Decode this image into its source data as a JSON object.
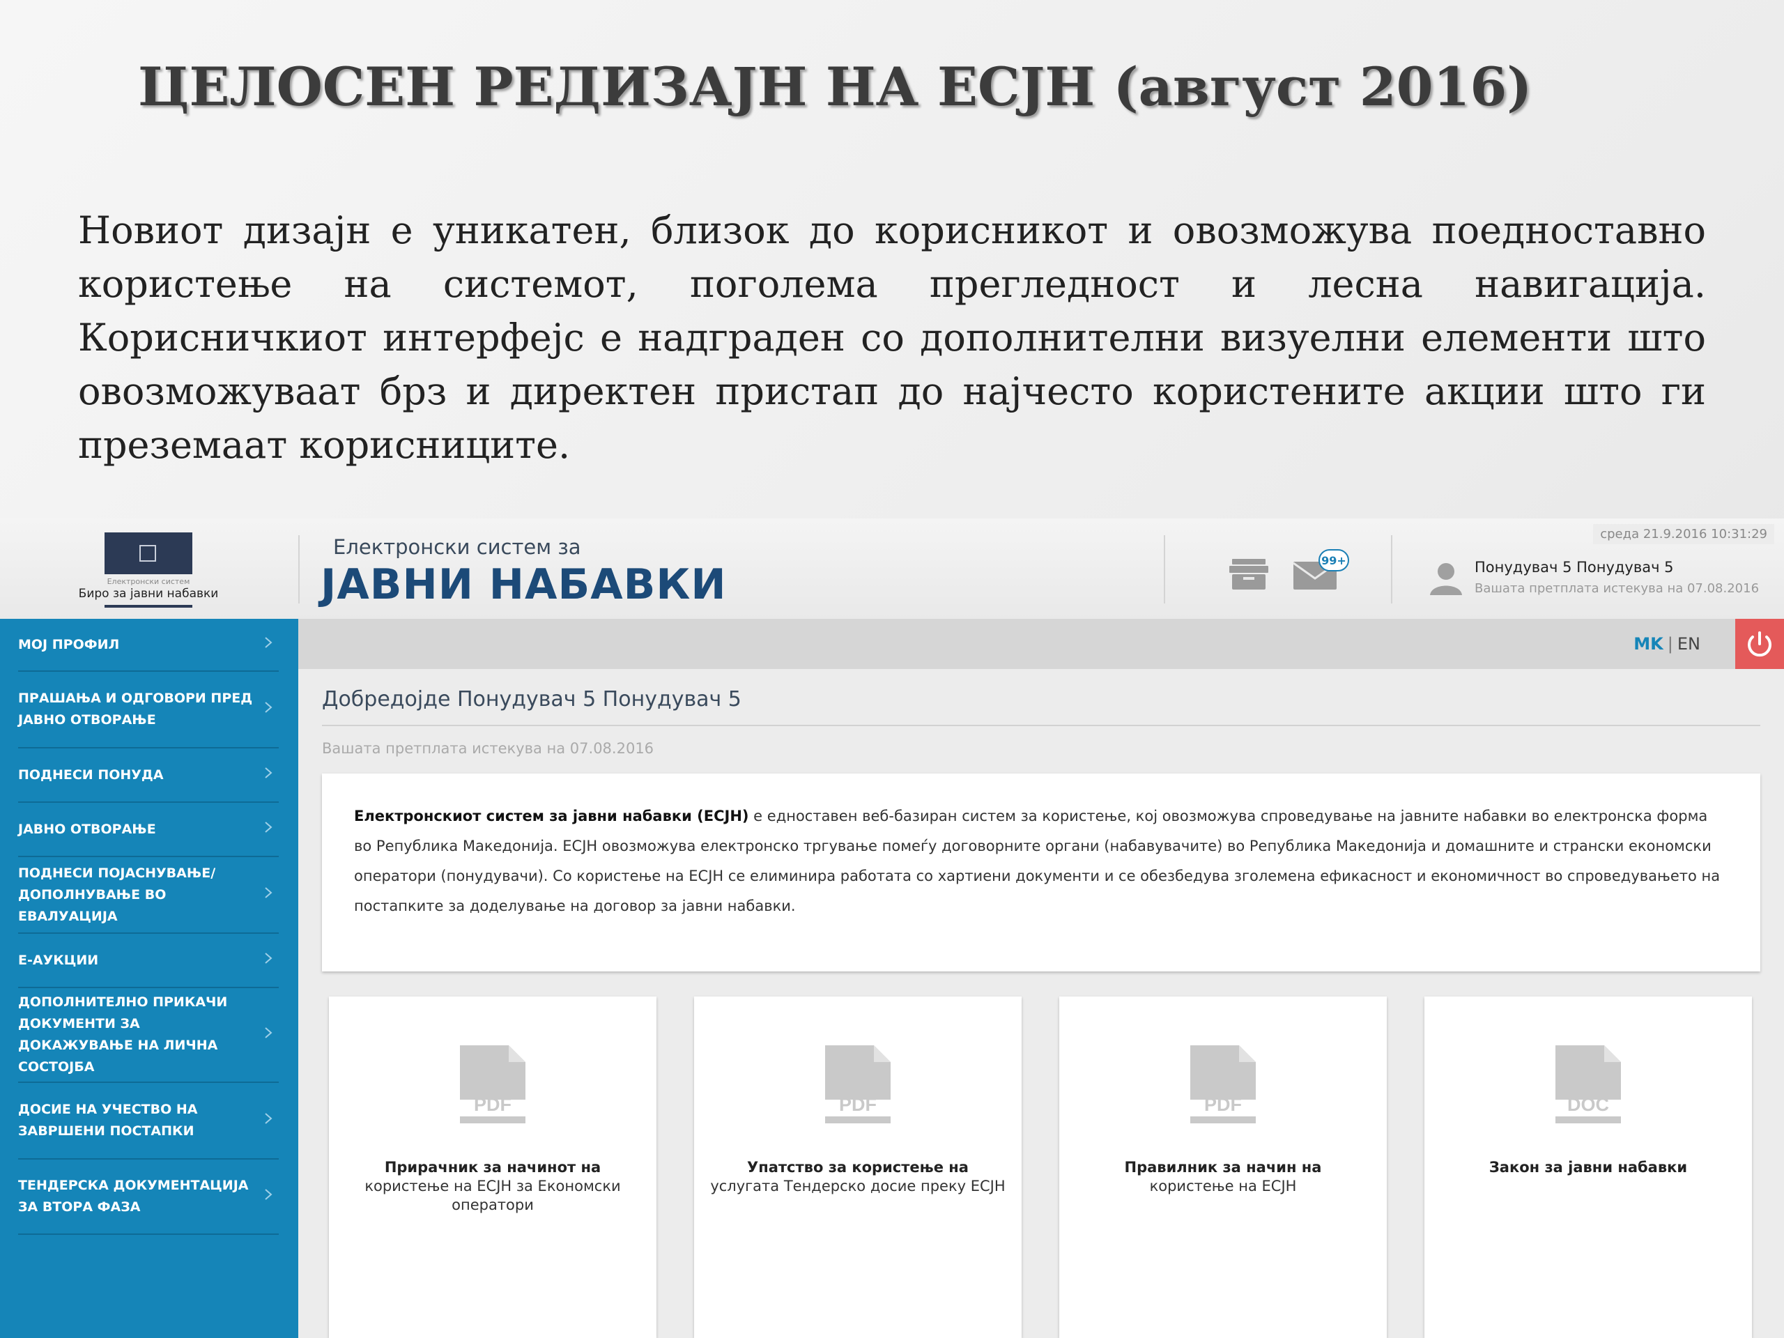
{
  "slide": {
    "title": "ЦЕЛОСЕН РЕДИЗАЈН НА ЕСЈН (август 2016)",
    "paragraph": "Новиот дизајн е уникатен, близок до корисникот и овозможува поедноставно користење на системот, поголема прегледност и лесна навигација. Корисничкиот интерфејс е надграден со дополнителни визуелни елементи што овозможуваат брз и директен пристап до најчесто користените акции што ги преземаат корисниците."
  },
  "header": {
    "logo_small": "Електронски систем",
    "logo_name": "Биро за јавни набавки",
    "system_small": "Електронски систем за",
    "system_big": "ЈАВНИ НАБАВКИ",
    "datetime": "среда 21.9.2016 10:31:29",
    "mail_badge": "99+",
    "user_name": "Понудувач 5 Понудувач 5",
    "user_sub": "Вашата претплата истекува на 07.08.2016"
  },
  "sidebar": {
    "items": [
      {
        "label": "МОЈ ПРОФИЛ"
      },
      {
        "label": "ПРАШАЊА И ОДГОВОРИ ПРЕД ЈАВНО ОТВОРАЊЕ"
      },
      {
        "label": "ПОДНЕСИ ПОНУДА"
      },
      {
        "label": "ЈАВНО ОТВОРАЊЕ"
      },
      {
        "label": "ПОДНЕСИ ПОЈАСНУВАЊЕ/ ДОПОЛНУВАЊЕ ВО ЕВАЛУАЦИЈА"
      },
      {
        "label": "Е-АУКЦИИ"
      },
      {
        "label": "ДОПОЛНИТЕЛНО ПРИКАЧИ ДОКУМЕНТИ ЗА ДОКАЖУВАЊЕ НА ЛИЧНА СОСТОЈБА"
      },
      {
        "label": "ДОСИЕ НА УЧЕСТВО НА ЗАВРШЕНИ ПОСТАПКИ"
      },
      {
        "label": "ТЕНДЕРСКА ДОКУМЕНТАЦИЈА ЗА ВТОРА ФАЗА"
      }
    ]
  },
  "lang": {
    "mk": "MK",
    "sep": "|",
    "en": "EN"
  },
  "main": {
    "welcome": "Добредојде Понудувач 5 Понудувач 5",
    "subscription": "Вашата претплата истекува на 07.08.2016",
    "info_bold": "Електронскиот систем за јавни набавки (ЕСЈН)",
    "info_rest": " е едноставен веб-базиран систем за користење, кој овозможува спроведување на јавните набавки во електронска форма во Република Македонија. ЕСЈН овозможува електронско тргување помеѓу договорните органи (набавувачите) во Република Македонија и домашните и странски економски оператори (понудувачи). Со користење на ЕСЈН се елиминира работата со хартиени документи и се обезбедува зголемена ефикасност и економичност во спроведувањето на постапките за доделување на договор за јавни набавки."
  },
  "cards": [
    {
      "type": "PDF",
      "title_bold": "Прирачник за начинот на",
      "title_rest": "користење на ЕСЈН за Економски оператори"
    },
    {
      "type": "PDF",
      "title_bold": "Упатство за користење на",
      "title_rest": "услугата Тендерско досие преку ЕСЈН"
    },
    {
      "type": "PDF",
      "title_bold": "Правилник за начин на",
      "title_rest": "користење на ЕСЈН"
    },
    {
      "type": "DOC",
      "title_bold": "Закон за јавни набавки",
      "title_rest": ""
    }
  ],
  "colors": {
    "sidebar": "#1585b8",
    "accent_blue": "#1c4a78",
    "power": "#e45a5a"
  }
}
